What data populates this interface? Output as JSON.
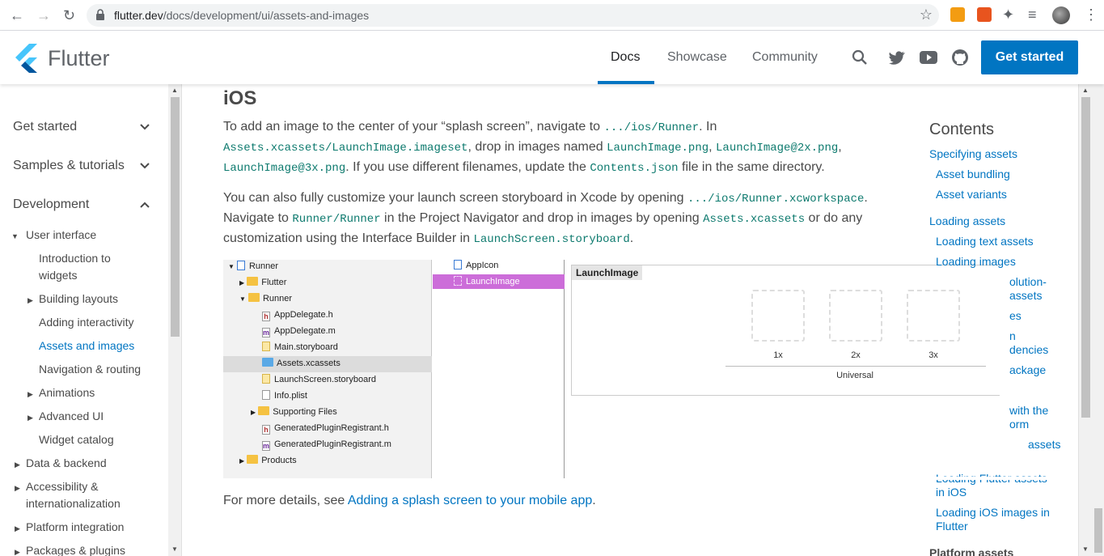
{
  "browser": {
    "url_host": "flutter.dev",
    "url_path": "/docs/development/ui/assets-and-images",
    "back_icon": "arrow-left-icon",
    "forward_icon": "arrow-right-icon",
    "reload_icon": "reload-icon"
  },
  "header": {
    "brand": "Flutter",
    "nav": [
      "Docs",
      "Showcase",
      "Community"
    ],
    "active_nav": "Docs",
    "cta": "Get started",
    "accent": "#0175c2"
  },
  "sidebar": {
    "top": [
      "Get started",
      "Samples & tutorials",
      "Development"
    ],
    "user_interface": "User interface",
    "items": [
      "Introduction to",
      "widgets",
      "Building layouts",
      "Adding interactivity",
      "Assets and images",
      "Navigation & routing",
      "Animations",
      "Advanced UI",
      "Widget catalog"
    ],
    "more": [
      "Data & backend",
      "Accessibility &",
      "internationalization",
      "Platform integration",
      "Packages & plugins"
    ]
  },
  "content": {
    "heading": "iOS",
    "p1": {
      "t1": "To add an image to the center of your “splash screen”, navigate to ",
      "c1": ".../ios/Runner",
      "t2": ". In",
      "c2": "Assets.xcassets/LaunchImage.imageset",
      "t3": ", drop in images named ",
      "c3": "LaunchImage.png",
      "t4": ", ",
      "c4": "LaunchImage@2x.png",
      "t5": ",",
      "c5": "LaunchImage@3x.png",
      "t6": ". If you use different filenames, update the ",
      "c6": "Contents.json",
      "t7": " file in the same directory."
    },
    "p2": {
      "t1": "You can also fully customize your launch screen storyboard in Xcode by opening ",
      "c1": ".../ios/Runner.xcworkspace",
      "t2": ".",
      "t3": "Navigate to ",
      "c2": "Runner/Runner",
      "t4": " in the Project Navigator and drop in images by opening ",
      "c3": "Assets.xcassets",
      "t5": " or do any",
      "t6": "customization using the Interface Builder in ",
      "c4": "LaunchScreen.storyboard",
      "t7": "."
    },
    "p3": {
      "t1": "For more details, see ",
      "link": "Adding a splash screen to your mobile app",
      "t2": "."
    }
  },
  "xcode": {
    "tree": [
      {
        "label": "Runner"
      },
      {
        "label": "Flutter"
      },
      {
        "label": "Runner"
      },
      {
        "label": "AppDelegate.h",
        "badge": "h"
      },
      {
        "label": "AppDelegate.m",
        "badge": "m"
      },
      {
        "label": "Main.storyboard"
      },
      {
        "label": "Assets.xcassets"
      },
      {
        "label": "LaunchScreen.storyboard"
      },
      {
        "label": "Info.plist"
      },
      {
        "label": "Supporting Files"
      },
      {
        "label": "GeneratedPluginRegistrant.h",
        "badge": "h"
      },
      {
        "label": "GeneratedPluginRegistrant.m",
        "badge": "m"
      },
      {
        "label": "Products"
      }
    ],
    "sets": [
      "AppIcon",
      "LaunchImage"
    ],
    "canvas_title": "LaunchImage",
    "slots": [
      "1x",
      "2x",
      "3x"
    ],
    "universal": "Universal"
  },
  "toc": {
    "heading": "Contents",
    "items": [
      "Specifying assets",
      "Asset bundling",
      "Asset variants",
      "Loading assets",
      "Loading text assets",
      "Loading images",
      "olution-",
      "assets",
      "es",
      "n",
      "dencies",
      "ackage",
      "with the",
      "orm",
      "assets",
      "Loading Flutter assets",
      "in iOS",
      "Loading iOS images in",
      "Flutter",
      "Platform assets"
    ]
  }
}
